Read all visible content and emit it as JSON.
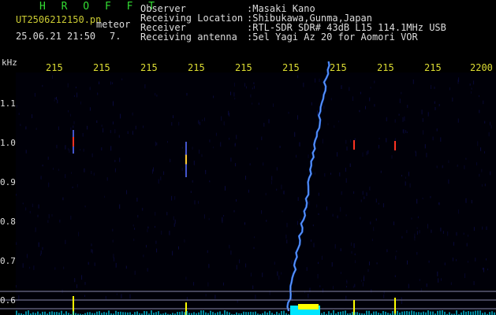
{
  "header": {
    "app_title": "H R O F F T",
    "file_name": "UT2506212150.pn",
    "event_type": "meteor",
    "datetime": "25.06.21 21:50",
    "count": "7.",
    "info_rows": [
      {
        "label": "Observer",
        "value": ":Masaki Kano"
      },
      {
        "label": "Receiving Location",
        "value": ":Shibukawa,Gunma,Japan"
      },
      {
        "label": "Receiver",
        "value": ":RTL-SDR SDR# 43dB L15 114.1MHz USB"
      },
      {
        "label": "Receiving antenna",
        "value": ":5el Yagi Az 20 for Aomori VOR"
      }
    ]
  },
  "spectrogram": {
    "y_unit": "kHz",
    "time_ticks": [
      "215",
      "215",
      "215",
      "215",
      "215",
      "215",
      "215",
      "215",
      "215",
      "2200"
    ],
    "freq_ticks": [
      "1.1",
      "1.0",
      "0.9",
      "0.8",
      "0.7",
      "0.6"
    ],
    "colors": {
      "background": "#000008",
      "noise": "#0a0a40",
      "meteor_trail": "#3377ff",
      "ping_hot": "#ff3322",
      "ping_warm": "#ffcc33",
      "ref_lines": "#8888aa",
      "signal_yellow": "#ffff00",
      "signal_cyan": "#00e5ff"
    }
  }
}
